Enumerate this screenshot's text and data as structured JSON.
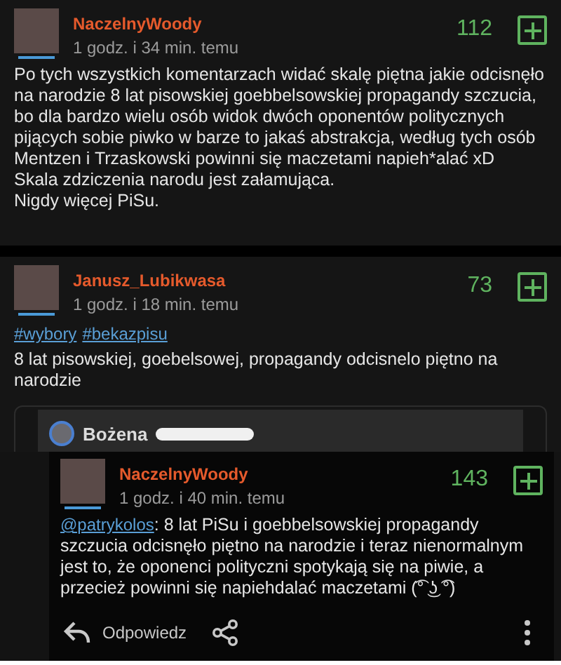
{
  "comments": [
    {
      "author": "NaczelnyWoody",
      "time": "1 godz. i 34 min. temu",
      "score": "112",
      "text": "Po tych wszystkich komentarzach widać skalę piętna jakie odcisnęło na narodzie 8 lat pisowskiej goebbelsowskiej propagandy szczucia, bo dla bardzo wielu osób widok dwóch oponentów politycznych pijących sobie piwko w barze to jakaś abstrakcja, według tych osób Mentzen i Trzaskowski powinni się maczetami napieh*alać xD\nSkala zdziczenia narodu jest załamująca.\nNigdy więcej PiSu."
    },
    {
      "author": "Janusz_Lubikwasa",
      "time": "1 godz. i 18 min. temu",
      "score": "73",
      "tags": [
        "#wybory",
        "#bekazpisu"
      ],
      "text": "8 lat pisowskiej, goebelsowej, propagandy odcisnelo piętno na narodzie",
      "embed": {
        "author": "Bożena"
      }
    },
    {
      "author": "NaczelnyWoody",
      "time": "1 godz. i 40 min. temu",
      "score": "143",
      "mention": "@patrykolos",
      "text": ": 8 lat PiSu i goebbelsowskiej propagandy szczucia odcisnęło piętno na narodzie i teraz nienormalnym jest to, że oponenci polityczni spotykają się na piwie, a przecież powinni się napiehdalać maczetami (͡° ͜ʖ ͡°)",
      "reply": "Odpowiedz"
    }
  ]
}
